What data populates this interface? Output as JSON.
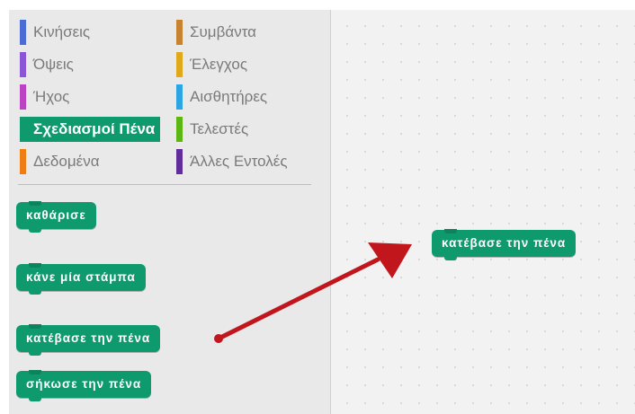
{
  "colors": {
    "pen_block": "#0e9a6c",
    "palette_bg": "#e9e9e9",
    "arrow": "#c0161c"
  },
  "categories": [
    {
      "label": "Κινήσεις",
      "color": "#4a6cd4",
      "selected": false
    },
    {
      "label": "Όψεις",
      "color": "#8a55d7",
      "selected": false
    },
    {
      "label": "Ήχος",
      "color": "#bb42c3",
      "selected": false
    },
    {
      "label": "Σχεδιασμοί Πένα",
      "color": "#0e9a6c",
      "selected": true
    },
    {
      "label": "Δεδομένα",
      "color": "#ee7d16",
      "selected": false
    },
    {
      "label": "Συμβάντα",
      "color": "#c88330",
      "selected": false
    },
    {
      "label": "Έλεγχος",
      "color": "#e1a91a",
      "selected": false
    },
    {
      "label": "Αισθητήρες",
      "color": "#2ca5e2",
      "selected": false
    },
    {
      "label": "Τελεστές",
      "color": "#5cb712",
      "selected": false
    },
    {
      "label": "Άλλες Εντολές",
      "color": "#632d99",
      "selected": false
    }
  ],
  "palette_blocks": [
    {
      "label": "καθάρισε"
    },
    {
      "label": "κάνε μία στάμπα"
    },
    {
      "label": "κατέβασε την πένα"
    },
    {
      "label": "σήκωσε την πένα"
    }
  ],
  "script_blocks": [
    {
      "label": "κατέβασε την πένα"
    }
  ]
}
